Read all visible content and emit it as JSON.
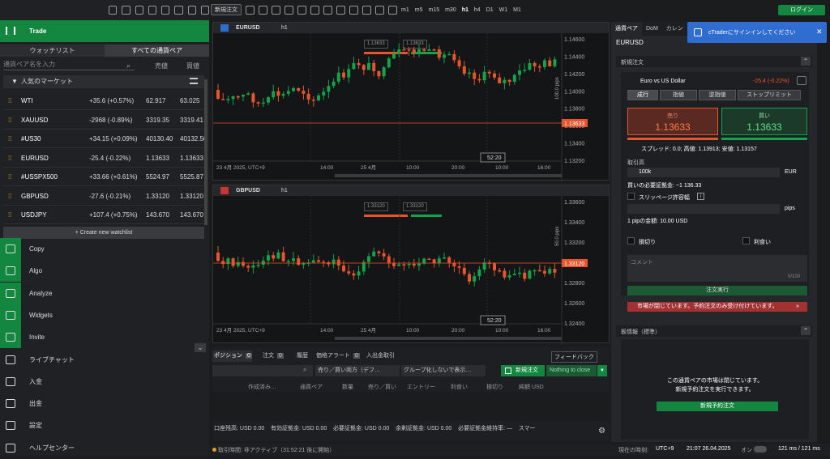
{
  "topbar": {
    "new_order": "新規注文",
    "login": "ログイン",
    "timeframes": [
      "m1",
      "m5",
      "m15",
      "m30",
      "h1",
      "h4",
      "D1",
      "W1",
      "M1"
    ]
  },
  "left": {
    "trade": "Trade",
    "tabs": [
      "ウォッチリスト",
      "すべての通貨ペア"
    ],
    "search_placeholder": "通貨ペア名を入力",
    "col_sell": "売値",
    "col_buy": "買値",
    "popular": "人気のマーケット",
    "rows": [
      {
        "sym": "WTI",
        "chg": "+35.6 (+0.57%)",
        "sell": "62.917",
        "buy": "63.025"
      },
      {
        "sym": "XAUUSD",
        "chg": "-2968 (-0.89%)",
        "sell": "3319.35",
        "buy": "3319.41"
      },
      {
        "sym": "#US30",
        "chg": "+34.15 (+0.09%)",
        "sell": "40130.40",
        "buy": "40132.50"
      },
      {
        "sym": "EURUSD",
        "chg": "-25.4 (-0.22%)",
        "sell": "1.13633",
        "buy": "1.13633"
      },
      {
        "sym": "#USSPX500",
        "chg": "+33.66 (+0.61%)",
        "sell": "5524.97",
        "buy": "5525.87"
      },
      {
        "sym": "GBPUSD",
        "chg": "-27.6 (-0.21%)",
        "sell": "1.33120",
        "buy": "1.33120"
      },
      {
        "sym": "USDJPY",
        "chg": "+107.4 (+0.75%)",
        "sell": "143.670",
        "buy": "143.670"
      }
    ],
    "create_wl": "+ Create new watchlist",
    "nav": [
      "Copy",
      "Algo",
      "Analyze",
      "Widgets",
      "Invite",
      "ライブチャット",
      "入金",
      "出金",
      "設定",
      "ヘルプセンター"
    ]
  },
  "charts": [
    {
      "symbol": "EURUSD",
      "tf": "h1",
      "bid": "1.13633",
      "ask": "1.13633",
      "prices": [
        "1.14600",
        "1.14400",
        "1.14200",
        "1.14000",
        "1.13800",
        "1.13600",
        "1.13400",
        "1.13200"
      ],
      "last": "1.13633",
      "range": "100.0 pips",
      "times": [
        "23 4月 2025, UTC+9",
        "14:00",
        "25 4月",
        "10:00",
        "20:00",
        "10:00",
        "16:00"
      ],
      "timer": "52:20"
    },
    {
      "symbol": "GBPUSD",
      "tf": "h1",
      "bid": "1.33120",
      "ask": "1.33120",
      "prices": [
        "1.33600",
        "1.33400",
        "1.33200",
        "1.33000",
        "1.32800",
        "1.32600",
        "1.32400"
      ],
      "last": "1.33120",
      "range": "50.0 pips",
      "times": [
        "23 4月 2025, UTC+9",
        "14:00",
        "25 4月",
        "10:00",
        "20:00",
        "10:00",
        "16:00"
      ],
      "timer": "52:20"
    }
  ],
  "right": {
    "tabs": [
      "通貨ペア",
      "DoM",
      "カレン"
    ],
    "symbol": "EURUSD",
    "new_order": "新規注文",
    "pair_name": "Euro vs US Dollar",
    "pair_chg": "-25.4 (-0.22%)",
    "order_types": [
      "成行",
      "指値",
      "逆指値",
      "ストップリミット"
    ],
    "sell_label": "売り",
    "sell_px": "1.13633",
    "buy_label": "買い",
    "buy_px": "1.13633",
    "spread": "スプレッド: 0.0; 高値: 1.13913; 安値: 1.13157",
    "volume_label": "取引高",
    "volume": "100k",
    "ccy": "EUR",
    "margin": "買いの必要証拠金: ~1 136.33",
    "slippage": "スリッページ許容幅",
    "pips": "pips",
    "pip_value": "1 pipの金額: 10.00 USD",
    "tp": "損切り",
    "sl": "利食い",
    "comment": "コメント",
    "comment_count": "0/100",
    "execute": "注文実行",
    "market_closed": "市場が閉じています。予約注文のみ受け付けています。",
    "book": "板情報（標準）",
    "book_msg1": "この通貨ペアの市場は閉じています。",
    "book_msg2": "新規予約注文を実行できます。",
    "book_btn": "新規予約注文"
  },
  "toast": "cTraderにサインインしてください",
  "bottom": {
    "tabs": [
      {
        "l": "ポジション",
        "c": "0"
      },
      {
        "l": "注文",
        "c": "0"
      },
      {
        "l": "履歴",
        "c": ""
      },
      {
        "l": "価格アラート",
        "c": "0"
      },
      {
        "l": "入出金取引",
        "c": ""
      }
    ],
    "feedback": "フィードバック",
    "filter1": "売り／買い両方（デフ…",
    "filter2": "グループ化しないで表示…",
    "new_order": "新規注文",
    "nothing": "Nothing to close",
    "cols": [
      "作成済み…",
      "通貨ペア",
      "数量",
      "売り／買い",
      "エントリー",
      "利食い",
      "損切り",
      "純額 USD"
    ],
    "summary": "口座残高: USD 0.00    有効証拠金: USD 0.00    必要証拠金: USD 0.00    余剰証拠金: USD 0.00    必要証拠金維持率: —    スマー"
  },
  "status": {
    "trading": "取引時間: 非アクティブ（31:52:21 後に開始）",
    "now": "現在の時刻:",
    "tz": "UTC+9",
    "time": "21:07 26.04.2025",
    "on": "オン",
    "ms": "121 ms / 121 ms"
  }
}
